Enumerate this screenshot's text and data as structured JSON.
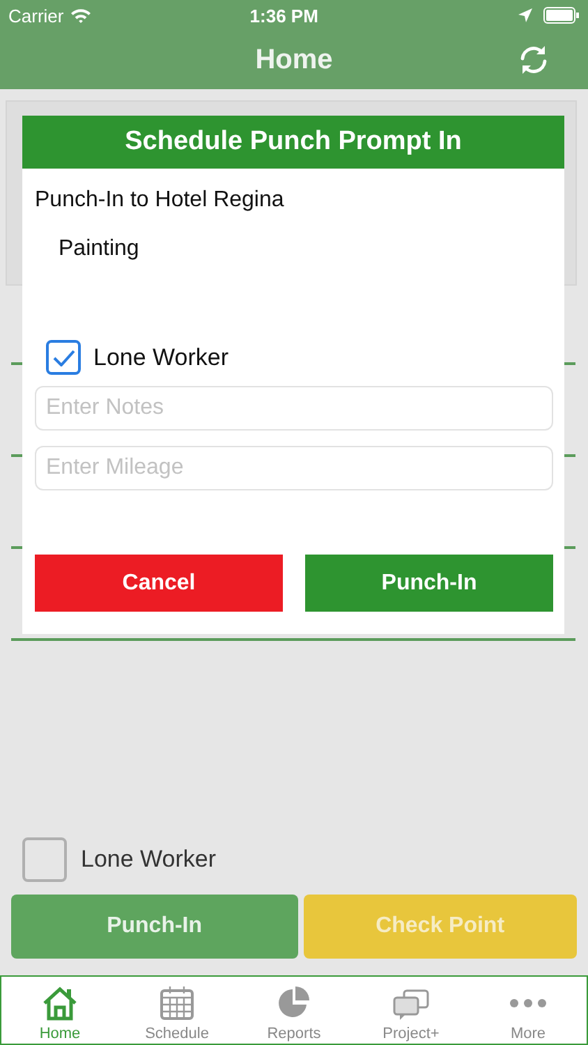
{
  "status_bar": {
    "carrier": "Carrier",
    "time": "1:36 PM"
  },
  "nav": {
    "title": "Home"
  },
  "dialog": {
    "title": "Schedule Punch Prompt In",
    "message": "Punch-In to Hotel Regina",
    "task": "Painting",
    "lone_worker": {
      "label": "Lone Worker",
      "checked": true
    },
    "notes": {
      "placeholder": "Enter Notes"
    },
    "mileage": {
      "placeholder": "Enter Mileage"
    },
    "buttons": [
      {
        "label": "Cancel",
        "kind": "cancel"
      },
      {
        "label": "Punch-In",
        "kind": "confirm"
      }
    ]
  },
  "lone_worker": {
    "label": "Lone Worker",
    "checked": false
  },
  "actions": [
    {
      "label": "Punch-In",
      "kind": "punch"
    },
    {
      "label": "Check Point",
      "kind": "checkpoint"
    }
  ],
  "tabs": [
    {
      "label": "Home",
      "selected": true
    },
    {
      "label": "Schedule",
      "selected": false
    },
    {
      "label": "Reports",
      "selected": false
    },
    {
      "label": "Project+",
      "selected": false
    },
    {
      "label": "More",
      "selected": false
    }
  ]
}
